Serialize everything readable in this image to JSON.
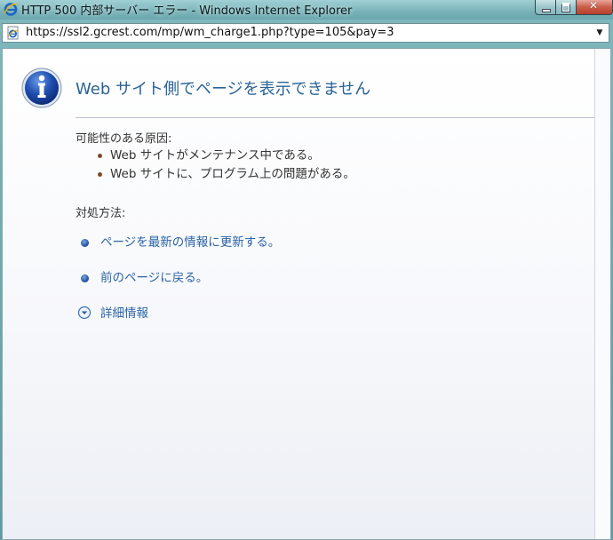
{
  "window": {
    "title": "HTTP 500 内部サーバー エラー - Windows Internet Explorer",
    "browser_icon": "ie-icon"
  },
  "address_bar": {
    "url": "https://ssl2.gcrest.com/mp/wm_charge1.php?type=105&pay=3",
    "page_icon": "ie-page-icon"
  },
  "error_page": {
    "icon": "info-icon",
    "heading": "Web サイト側でページを表示できません",
    "causes_label": "可能性のある原因:",
    "causes": [
      {
        "text": "Web サイトがメンテナンス中である。"
      },
      {
        "text": "Web サイトに、プログラム上の問題がある。"
      }
    ],
    "actions_label": "対処方法:",
    "actions": [
      {
        "label": "ページを最新の情報に更新する。"
      },
      {
        "label": "前のページに戻る。"
      }
    ],
    "details_label": "詳細情報"
  },
  "colors": {
    "heading": "#2a6496",
    "link": "#2a63a6",
    "title_bar": "#78b2b8"
  }
}
